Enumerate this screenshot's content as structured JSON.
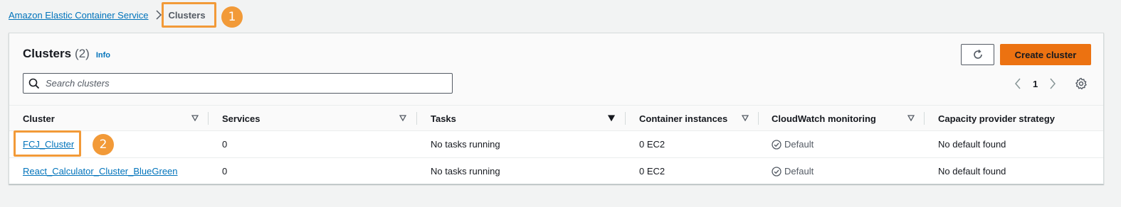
{
  "breadcrumb": {
    "parent": "Amazon Elastic Container Service",
    "current": "Clusters"
  },
  "annotations": [
    "1",
    "2"
  ],
  "panel": {
    "title": "Clusters",
    "count": "(2)",
    "info": "Info",
    "create_label": "Create cluster",
    "search_placeholder": "Search clusters",
    "page": "1"
  },
  "table": {
    "columns": [
      "Cluster",
      "Services",
      "Tasks",
      "Container instances",
      "CloudWatch monitoring",
      "Capacity provider strategy"
    ],
    "rows": [
      {
        "cluster": "FCJ_Cluster",
        "services": "0",
        "tasks": "No tasks running",
        "instances": "0 EC2",
        "monitoring": "Default",
        "capacity": "No default found"
      },
      {
        "cluster": "React_Calculator_Cluster_BlueGreen",
        "services": "0",
        "tasks": "No tasks running",
        "instances": "0 EC2",
        "monitoring": "Default",
        "capacity": "No default found"
      }
    ]
  },
  "colors": {
    "accent": "#ec7211",
    "link": "#0073bb",
    "highlight": "#f29a38"
  },
  "icons": [
    "chevron-right-icon",
    "refresh-icon",
    "search-icon",
    "chevron-left-icon",
    "settings-gear-icon",
    "sort-caret-icon",
    "check-circle-icon"
  ]
}
